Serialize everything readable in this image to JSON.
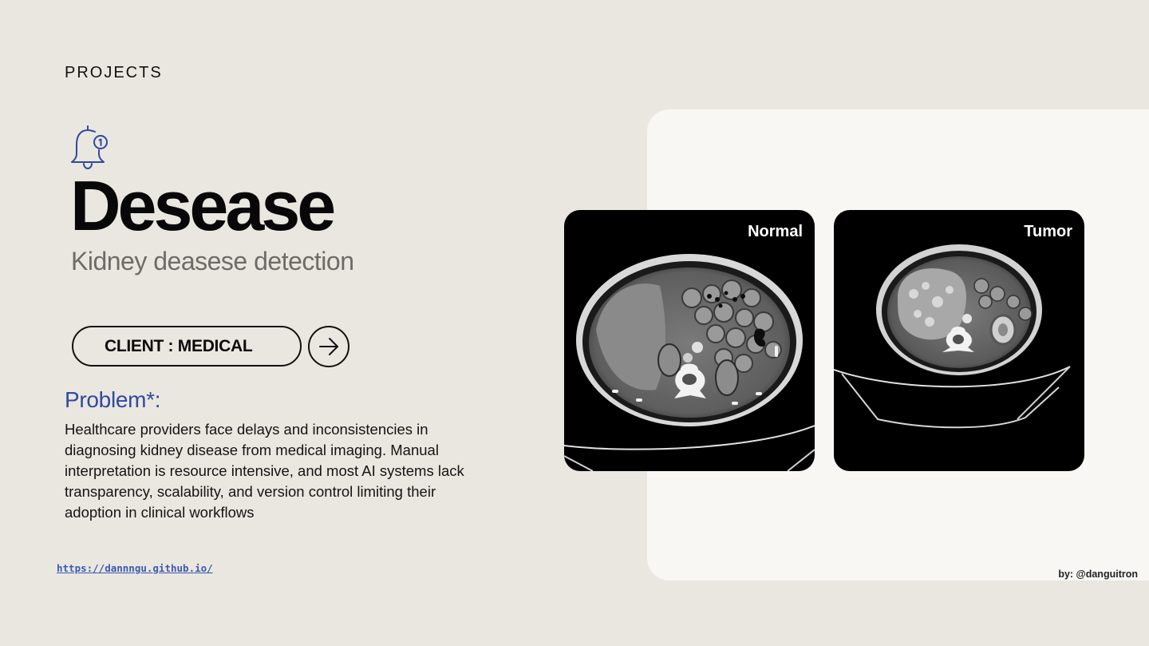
{
  "section_label": "PROJECTS",
  "title": "Desease",
  "subtitle": "Kidney deasese detection",
  "client_button": "CLIENT : MEDICAL",
  "problem": {
    "heading": "Problem*:",
    "body": "Healthcare providers face delays and inconsistencies in diagnosing kidney disease from medical imaging. Manual interpretation is resource intensive, and most AI systems lack transparency, scalability, and version control limiting their adoption in clinical workflows"
  },
  "link": "https://dannngu.github.io/",
  "images": {
    "normal_label": "Normal",
    "tumor_label": "Tumor"
  },
  "byline": "by: @danguitron",
  "icons": [
    "bell-icon",
    "arrow-right-icon"
  ],
  "colors": {
    "background": "#eae7e0",
    "panel": "#f8f7f4",
    "accent": "#2f4aa0",
    "subtitle": "#6e6b68"
  }
}
